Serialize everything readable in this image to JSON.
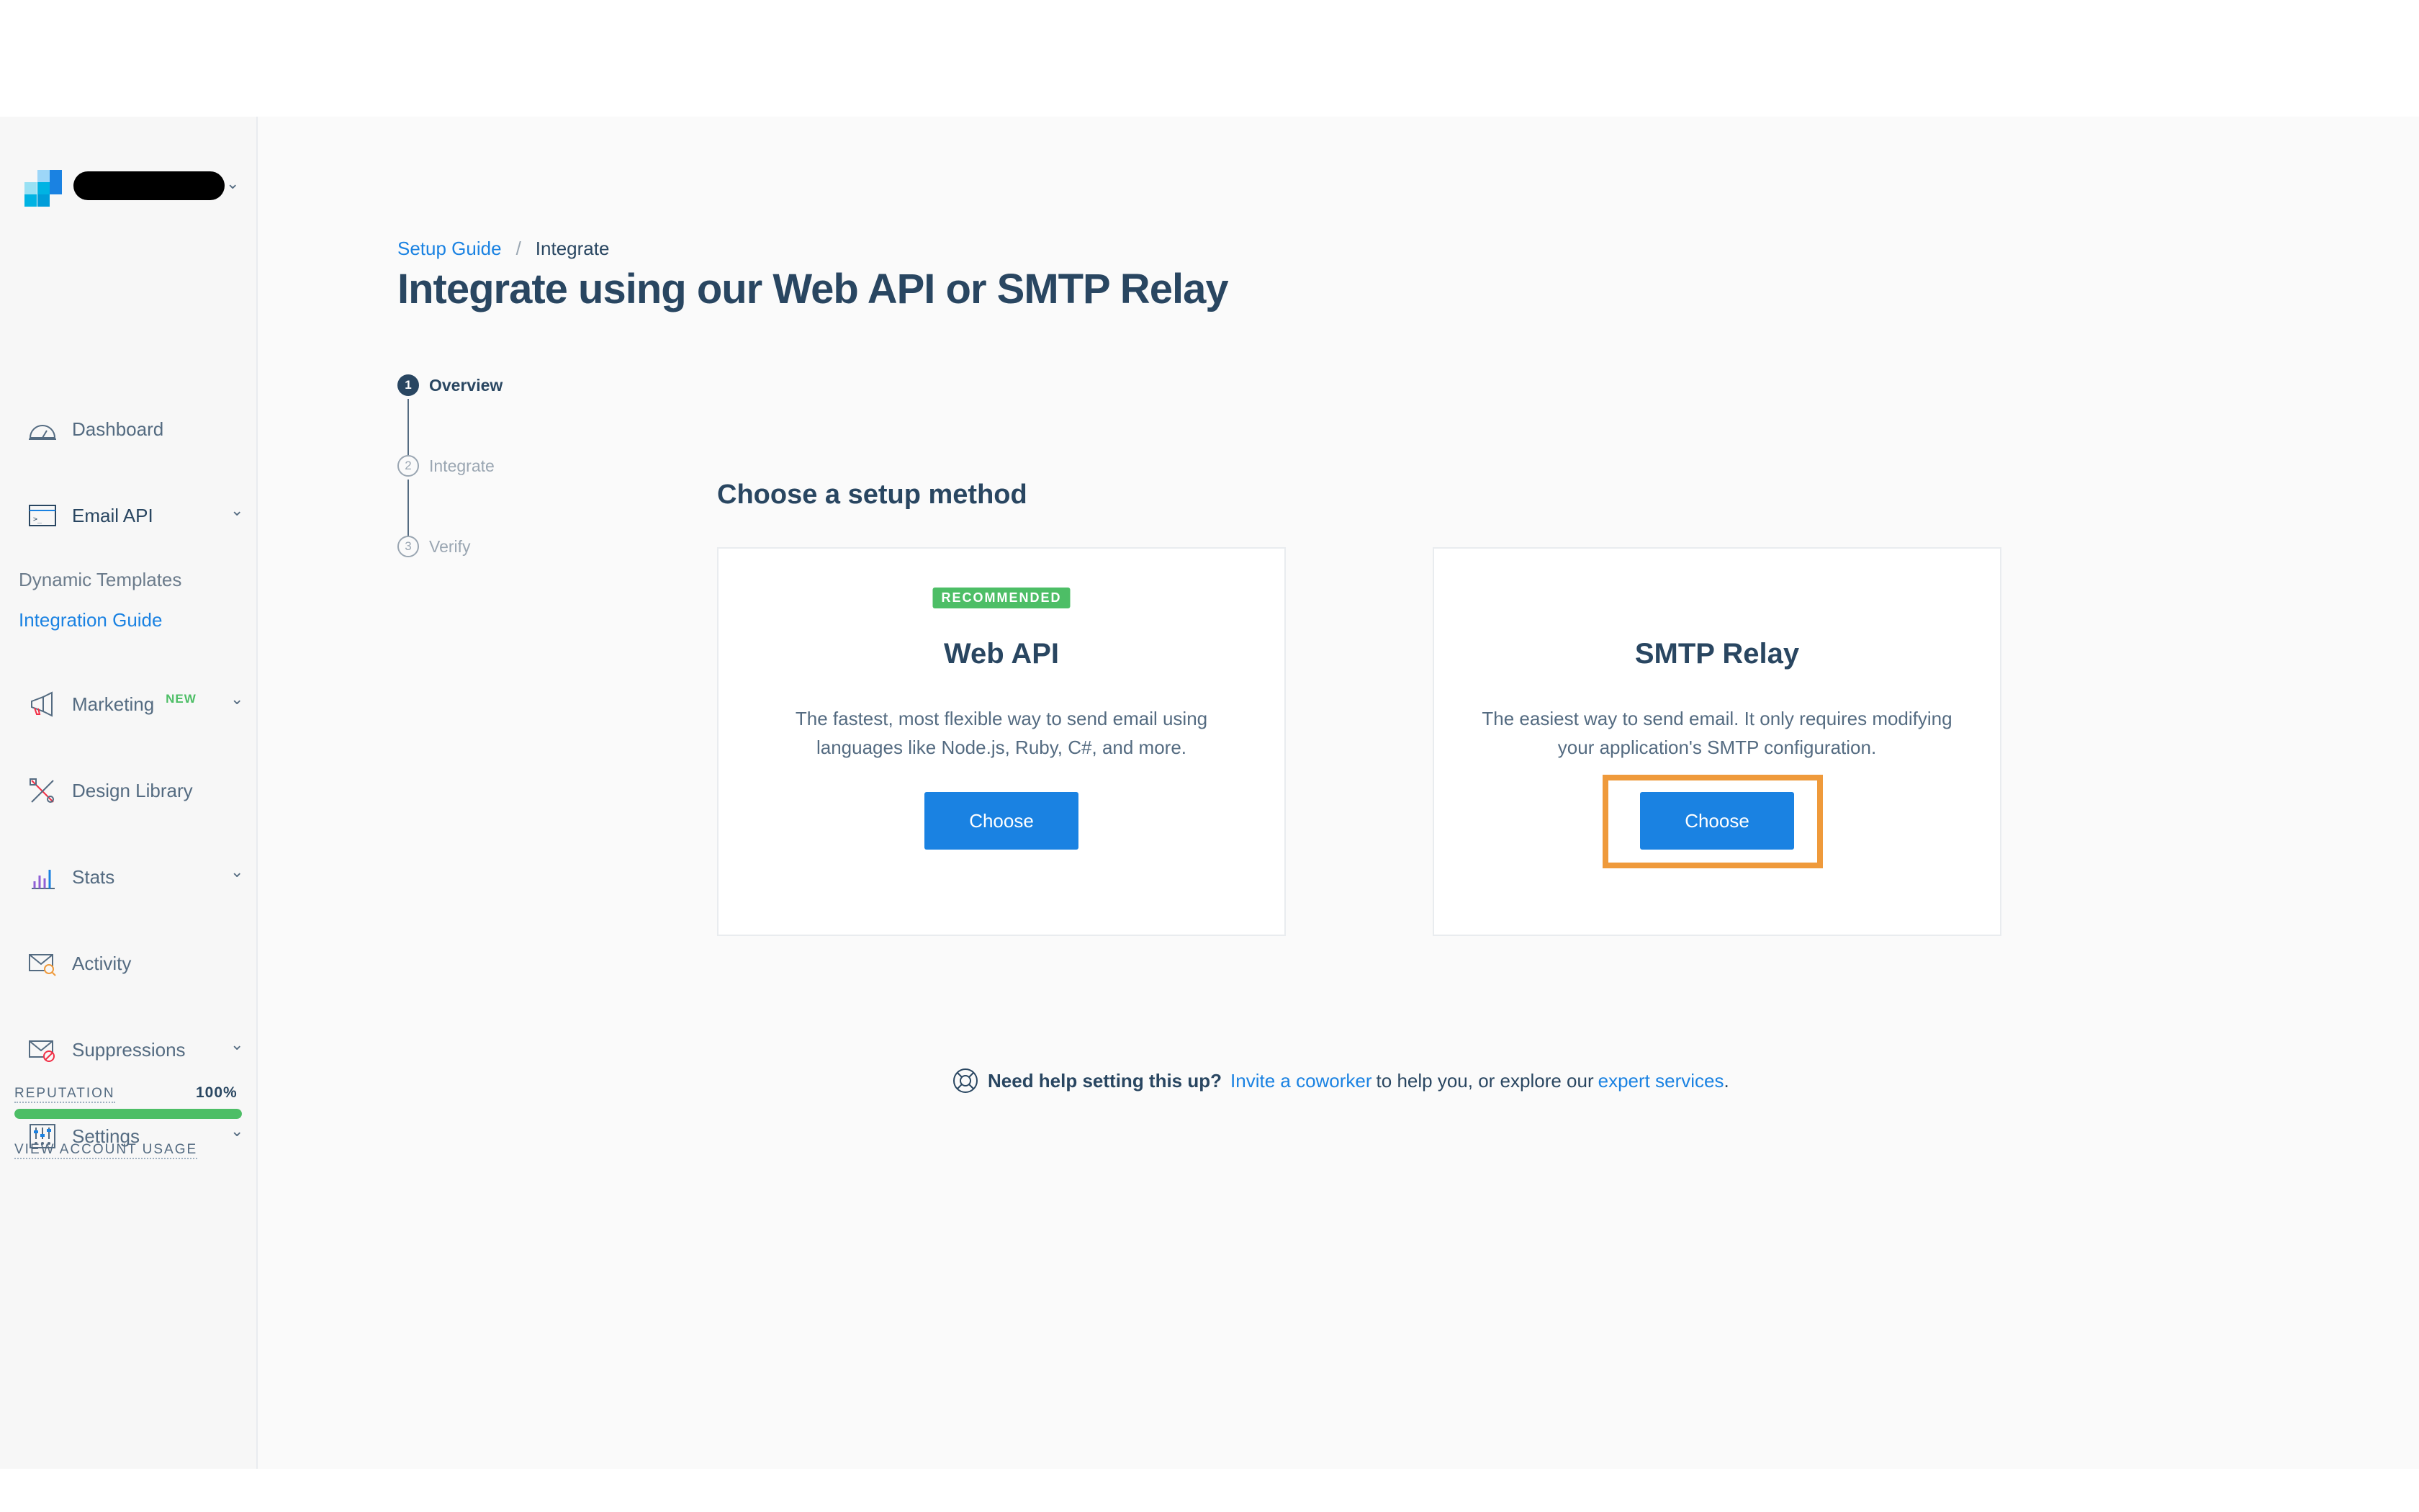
{
  "sidebar": {
    "account_chevron": "⌄",
    "items": [
      {
        "label": "Dashboard",
        "icon": "dashboard-icon"
      },
      {
        "label": "Email API",
        "icon": "email-api-icon",
        "chevron": "⌄"
      },
      {
        "label": "Marketing",
        "icon": "megaphone-icon",
        "badge": "NEW",
        "chevron": "⌄"
      },
      {
        "label": "Design Library",
        "icon": "design-tools-icon"
      },
      {
        "label": "Stats",
        "icon": "stats-chart-icon",
        "chevron": "⌄"
      },
      {
        "label": "Activity",
        "icon": "activity-mail-search-icon"
      },
      {
        "label": "Suppressions",
        "icon": "suppression-mail-block-icon",
        "chevron": "⌄"
      },
      {
        "label": "Settings",
        "icon": "settings-sliders-icon",
        "chevron": "⌄"
      }
    ],
    "sub_items": [
      {
        "label": "Dynamic Templates"
      },
      {
        "label": "Integration Guide",
        "active": true
      }
    ],
    "reputation": {
      "label": "REPUTATION",
      "value_text": "100%",
      "fraction": 1.0
    },
    "usage_link": "VIEW ACCOUNT USAGE"
  },
  "breadcrumb": {
    "link": "Setup Guide",
    "separator": "/",
    "current": "Integrate"
  },
  "page_title": "Integrate using our Web API or SMTP Relay",
  "steps": [
    {
      "num": "1",
      "label": "Overview",
      "state": "current"
    },
    {
      "num": "2",
      "label": "Integrate",
      "state": "pending"
    },
    {
      "num": "3",
      "label": "Verify",
      "state": "pending"
    }
  ],
  "section_title": "Choose a setup method",
  "cards": {
    "web_api": {
      "badge": "RECOMMENDED",
      "title": "Web API",
      "description": "The fastest, most flexible way to send email using languages like Node.js, Ruby, C#, and more.",
      "button": "Choose"
    },
    "smtp": {
      "title": "SMTP Relay",
      "description": "The easiest way to send email. It only requires modifying your application's SMTP configuration.",
      "button": "Choose"
    }
  },
  "help": {
    "bold": "Need help setting this up?",
    "link1": "Invite a coworker",
    "middle": "to help you, or explore our",
    "link2": "expert services",
    "end": "."
  },
  "colors": {
    "accent": "#1a82e2",
    "success": "#4dbe66",
    "highlight": "#ef9a3b",
    "text": "#294661"
  }
}
